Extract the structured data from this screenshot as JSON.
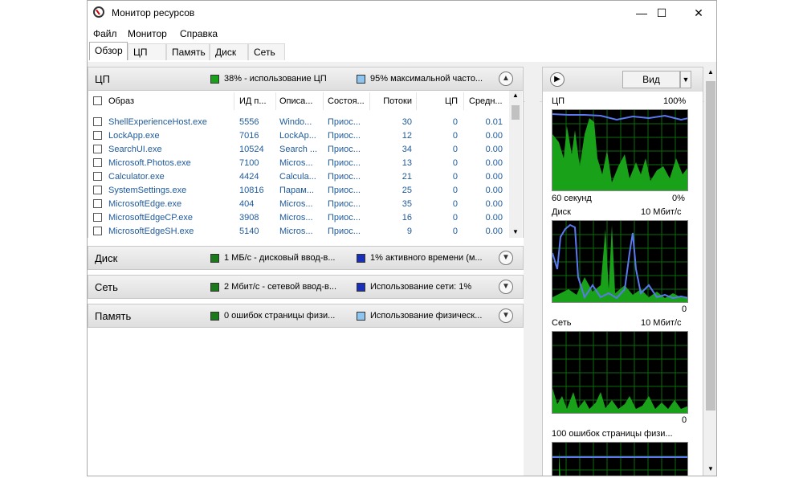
{
  "window": {
    "title": "Монитор ресурсов",
    "controls": {
      "minimize": "—",
      "maximize": "☐",
      "close": "✕"
    }
  },
  "menu": [
    "Файл",
    "Монитор",
    "Справка"
  ],
  "tabs": [
    "Обзор",
    "ЦП",
    "Память",
    "Диск",
    "Сеть"
  ],
  "active_tab": "Обзор",
  "cpu": {
    "title": "ЦП",
    "stat1": "38% - использование ЦП",
    "stat2": "95% максимальной часто...",
    "columns": [
      "Образ",
      "ИД п...",
      "Описа...",
      "Состоя...",
      "Потоки",
      "ЦП",
      "Средн..."
    ],
    "rows": [
      {
        "image": "ShellExperienceHost.exe",
        "pid": "5556",
        "desc": "Windo...",
        "state": "Приос...",
        "threads": "30",
        "cpu": "0",
        "avg": "0.01"
      },
      {
        "image": "LockApp.exe",
        "pid": "7016",
        "desc": "LockAp...",
        "state": "Приос...",
        "threads": "12",
        "cpu": "0",
        "avg": "0.00"
      },
      {
        "image": "SearchUI.exe",
        "pid": "10524",
        "desc": "Search ...",
        "state": "Приос...",
        "threads": "34",
        "cpu": "0",
        "avg": "0.00"
      },
      {
        "image": "Microsoft.Photos.exe",
        "pid": "7100",
        "desc": "Micros...",
        "state": "Приос...",
        "threads": "13",
        "cpu": "0",
        "avg": "0.00"
      },
      {
        "image": "Calculator.exe",
        "pid": "4424",
        "desc": "Calcula...",
        "state": "Приос...",
        "threads": "21",
        "cpu": "0",
        "avg": "0.00"
      },
      {
        "image": "SystemSettings.exe",
        "pid": "10816",
        "desc": "Парам...",
        "state": "Приос...",
        "threads": "25",
        "cpu": "0",
        "avg": "0.00"
      },
      {
        "image": "MicrosoftEdge.exe",
        "pid": "404",
        "desc": "Micros...",
        "state": "Приос...",
        "threads": "35",
        "cpu": "0",
        "avg": "0.00"
      },
      {
        "image": "MicrosoftEdgeCP.exe",
        "pid": "3908",
        "desc": "Micros...",
        "state": "Приос...",
        "threads": "16",
        "cpu": "0",
        "avg": "0.00"
      },
      {
        "image": "MicrosoftEdgeSH.exe",
        "pid": "5140",
        "desc": "Micros...",
        "state": "Приос...",
        "threads": "9",
        "cpu": "0",
        "avg": "0.00"
      }
    ]
  },
  "disk": {
    "title": "Диск",
    "stat1": "1 МБ/с - дисковый ввод-в...",
    "stat2": "1% активного времени (м..."
  },
  "network": {
    "title": "Сеть",
    "stat1": "2 Мбит/с - сетевой ввод-в...",
    "stat2": "Использование сети: 1%"
  },
  "memory": {
    "title": "Память",
    "stat1": "0 ошибок страницы физи...",
    "stat2": "Использование физическ..."
  },
  "right": {
    "view_label": "Вид",
    "cpu_graph": {
      "title": "ЦП",
      "max": "100%",
      "time": "60 секунд",
      "min": "0%"
    },
    "disk_graph": {
      "title": "Диск",
      "max": "10 Мбит/с",
      "min": "0"
    },
    "net_graph": {
      "title": "Сеть",
      "max": "10 Мбит/с",
      "min": "0"
    },
    "mem_graph": {
      "title": "100 ошибок страницы физи..."
    }
  },
  "colors": {
    "green": "#1aa11a",
    "blue": "#3a5bd9",
    "link": "#1f5a9a"
  }
}
